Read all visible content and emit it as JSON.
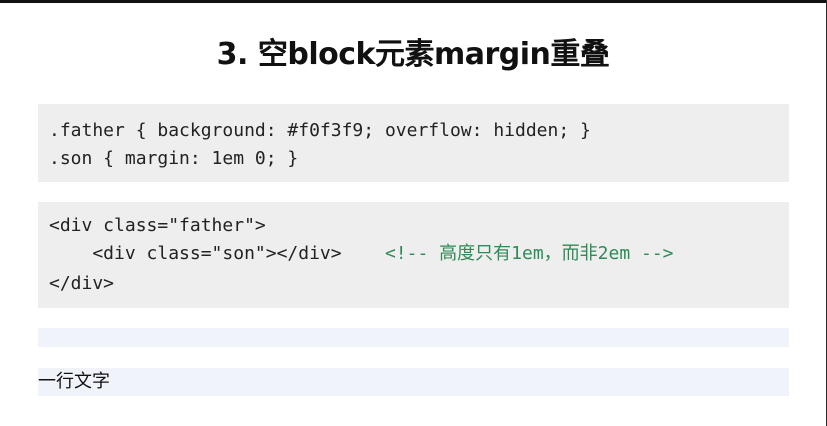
{
  "slide": {
    "title": "3. 空block元素margin重叠"
  },
  "css_code": {
    "line1": ".father { background: #f0f3f9; overflow: hidden; }",
    "line2": ".son { margin: 1em 0; }"
  },
  "html_code": {
    "line1": "<div class=\"father\">",
    "line2_code": "    <div class=\"son\"></div>",
    "line2_gap": "    ",
    "line2_comment": "<!-- 高度只有1em，而非2em -->",
    "line3": "</div>"
  },
  "demo": {
    "text_line": "一行文字"
  },
  "colors": {
    "code_background": "#eeeeee",
    "demo_background": "#f0f3f9",
    "comment": "#2e8b57"
  }
}
